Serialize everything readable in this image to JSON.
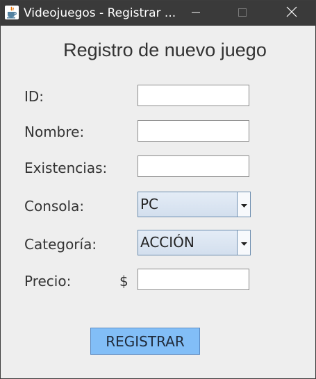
{
  "window": {
    "title": "Videojuegos - Registrar ...",
    "controls": {
      "minimize_icon": "minimize-icon",
      "maximize_icon": "maximize-icon",
      "close_icon": "close-icon"
    }
  },
  "form": {
    "heading": "Registro de nuevo juego",
    "fields": {
      "id": {
        "label": "ID:",
        "value": ""
      },
      "nombre": {
        "label": "Nombre:",
        "value": ""
      },
      "existencias": {
        "label": "Existencias:",
        "value": ""
      },
      "consola": {
        "label": "Consola:",
        "selected": "PC"
      },
      "categoria": {
        "label": "Categoría:",
        "selected": "ACCIÓN"
      },
      "precio": {
        "label": "Precio:",
        "currency": "$",
        "value": ""
      }
    },
    "submit_label": "REGISTRAR"
  },
  "colors": {
    "titlebar": "#3a3a3a",
    "background": "#eeeeee",
    "button": "#82bef7",
    "combo_border": "#6a8cae"
  }
}
